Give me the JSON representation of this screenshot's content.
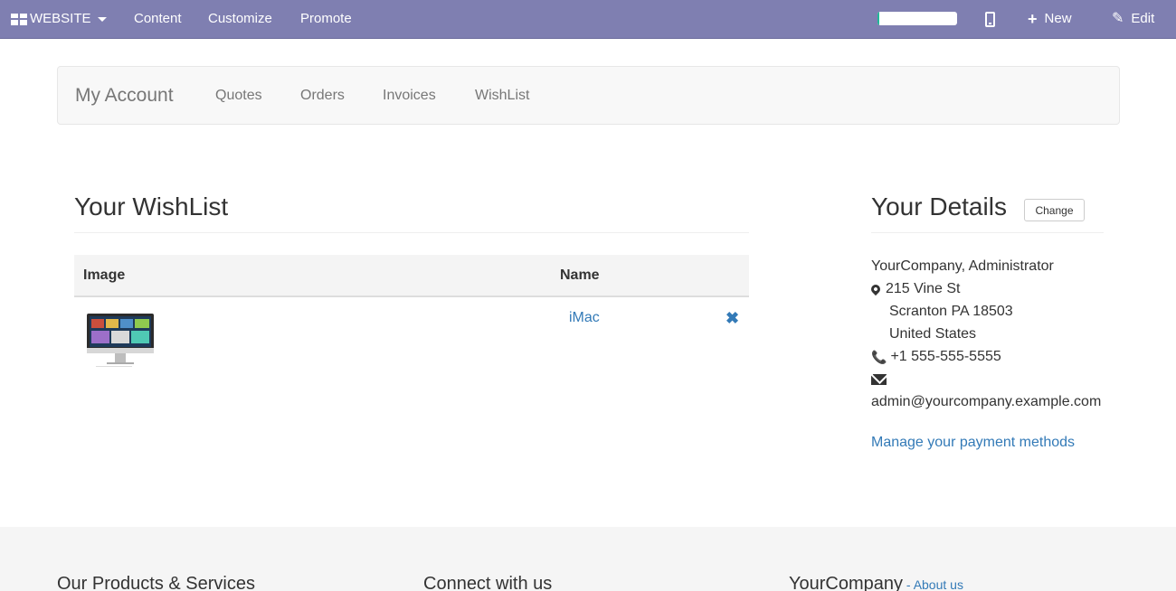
{
  "topbar": {
    "website_label": "WEBSITE",
    "content_label": "Content",
    "customize_label": "Customize",
    "promote_label": "Promote",
    "progress_fraction": 0.02,
    "new_label": "New",
    "edit_label": "Edit",
    "bar_color": "#7f7fb1"
  },
  "account_nav": {
    "brand": "My Account",
    "links": [
      "Quotes",
      "Orders",
      "Invoices",
      "WishList"
    ]
  },
  "wishlist": {
    "title": "Your WishList",
    "columns": [
      "Image",
      "Name"
    ],
    "rows": [
      {
        "image": "imac-thumbnail",
        "name": "iMac",
        "remove_icon": "close-icon"
      }
    ]
  },
  "details": {
    "title": "Your Details",
    "change_label": "Change",
    "name": "YourCompany, Administrator",
    "street": "215 Vine St",
    "city_line": "Scranton PA 18503",
    "country": "United States",
    "phone": "+1 555-555-5555",
    "email": "admin@yourcompany.example.com",
    "manage_link": "Manage your payment methods"
  },
  "footer": {
    "col1": "Our Products & Services",
    "col2": "Connect with us",
    "col3": "YourCompany",
    "about_sep": " - ",
    "about_link": "About us"
  },
  "colors": {
    "link": "#337ab7",
    "progress_fill": "#21b799"
  }
}
